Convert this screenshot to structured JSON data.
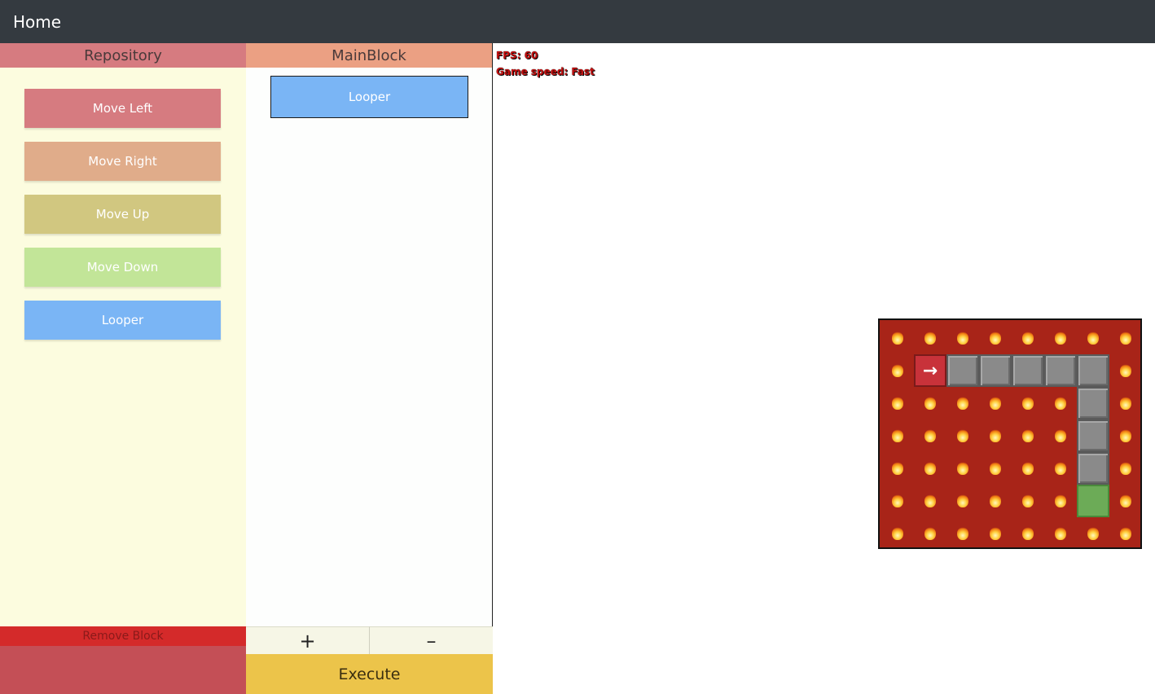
{
  "topbar": {
    "home_label": "Home"
  },
  "repository": {
    "title": "Repository",
    "blocks": [
      {
        "label": "Move Left",
        "color": "#d67b80"
      },
      {
        "label": "Move Right",
        "color": "#e0ac8a"
      },
      {
        "label": "Move Up",
        "color": "#d1c780"
      },
      {
        "label": "Move Down",
        "color": "#c2e598"
      },
      {
        "label": "Looper",
        "color": "#7ab5f5"
      }
    ],
    "remove_label": "Remove Block"
  },
  "main_block": {
    "title": "MainBlock",
    "items": [
      {
        "label": "Looper",
        "color": "#7ab5f5"
      }
    ],
    "plus_label": "+",
    "minus_label": "–",
    "execute_label": "Execute"
  },
  "game": {
    "fps_text": "FPS: 60",
    "speed_text": "Game speed: Fast",
    "grid": {
      "cols": 8,
      "rows": 7,
      "player": {
        "col": 1,
        "row": 1,
        "icon": "arrow-right-icon",
        "glyph": "→"
      },
      "path": [
        [
          2,
          1
        ],
        [
          3,
          1
        ],
        [
          4,
          1
        ],
        [
          5,
          1
        ],
        [
          6,
          1
        ],
        [
          6,
          2
        ],
        [
          6,
          3
        ],
        [
          6,
          4
        ]
      ],
      "goal": {
        "col": 6,
        "row": 5
      },
      "colors": {
        "lava": "#a82418",
        "path": "#8a8a8a",
        "goal": "#6cab57",
        "player": "#c8323a"
      }
    }
  }
}
